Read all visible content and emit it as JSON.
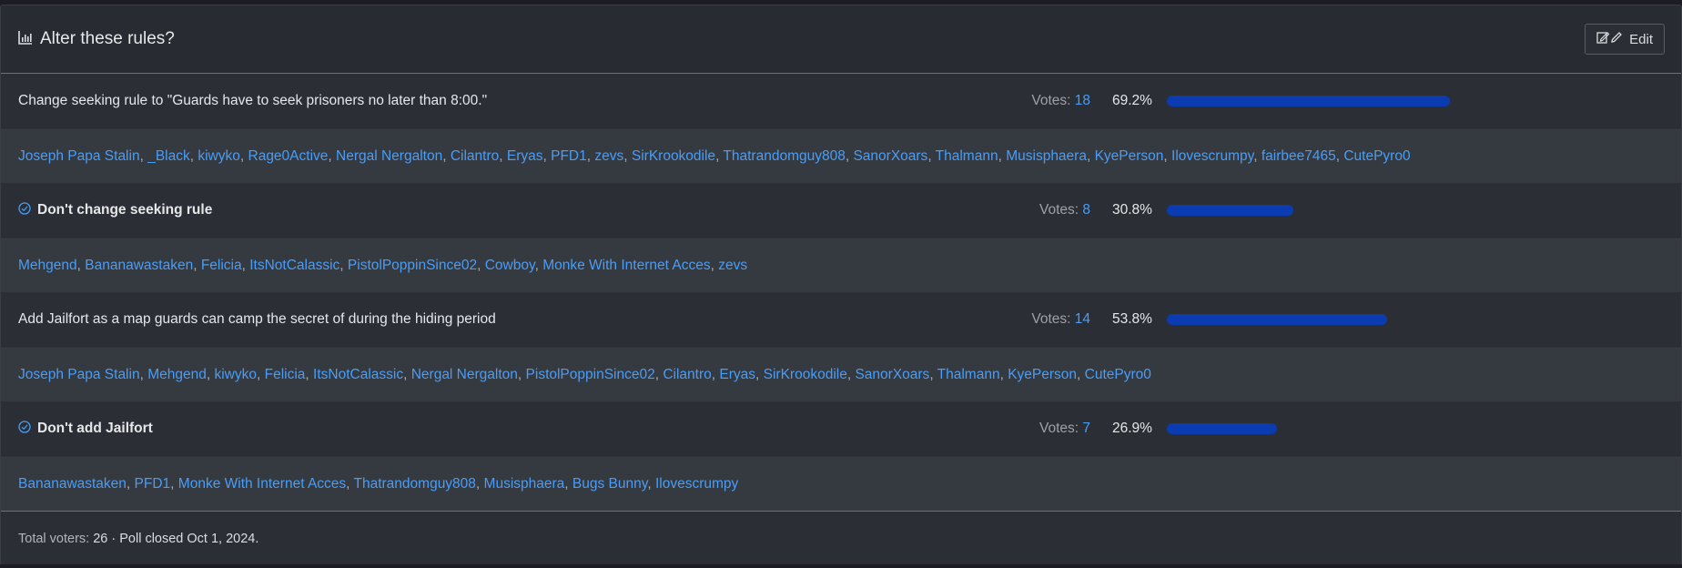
{
  "header": {
    "title": "Alter these rules?",
    "edit_label": "Edit"
  },
  "options": [
    {
      "label": "Change seeking rule to \"Guards have to seek prisoners no later than 8:00.\"",
      "selected": false,
      "votes_label": "Votes:",
      "votes": "18",
      "percent": "69.2%",
      "fraction": 0.692,
      "voters": [
        "Joseph Papa Stalin",
        "_Black",
        "kiwyko",
        "Rage0Active",
        "Nergal Nergalton",
        "Cilantro",
        "Eryas",
        "PFD1",
        "zevs",
        "SirKrookodile",
        "Thatrandomguy808",
        "SanorXoars",
        "Thalmann",
        "Musisphaera",
        "KyePerson",
        "Ilovescrumpy",
        "fairbee7465",
        "CutePyro0"
      ]
    },
    {
      "label": "Don't change seeking rule",
      "selected": true,
      "votes_label": "Votes:",
      "votes": "8",
      "percent": "30.8%",
      "fraction": 0.308,
      "voters": [
        "Mehgend",
        "Bananawastaken",
        "Felicia",
        "ItsNotCalassic",
        "PistolPoppinSince02",
        "Cowboy",
        "Monke With Internet Acces",
        "zevs"
      ]
    },
    {
      "label": "Add Jailfort as a map guards can camp the secret of during the hiding period",
      "selected": false,
      "votes_label": "Votes:",
      "votes": "14",
      "percent": "53.8%",
      "fraction": 0.538,
      "voters": [
        "Joseph Papa Stalin",
        "Mehgend",
        "kiwyko",
        "Felicia",
        "ItsNotCalassic",
        "Nergal Nergalton",
        "PistolPoppinSince02",
        "Cilantro",
        "Eryas",
        "SirKrookodile",
        "SanorXoars",
        "Thalmann",
        "KyePerson",
        "CutePyro0"
      ]
    },
    {
      "label": "Don't add Jailfort",
      "selected": true,
      "votes_label": "Votes:",
      "votes": "7",
      "percent": "26.9%",
      "fraction": 0.269,
      "voters": [
        "Bananawastaken",
        "PFD1",
        "Monke With Internet Acces",
        "Thatrandomguy808",
        "Musisphaera",
        "Bugs Bunny",
        "Ilovescrumpy"
      ]
    }
  ],
  "footer": {
    "total_label": "Total voters:",
    "total": "26",
    "separator": "·",
    "closed_text": "Poll closed Oct 1, 2024."
  },
  "colors": {
    "bar": "#0a3bb1",
    "link": "#4a9df6"
  },
  "icons": {
    "title": "bar-chart-icon",
    "edit": "edit-icon",
    "selected": "check-circle-icon"
  }
}
